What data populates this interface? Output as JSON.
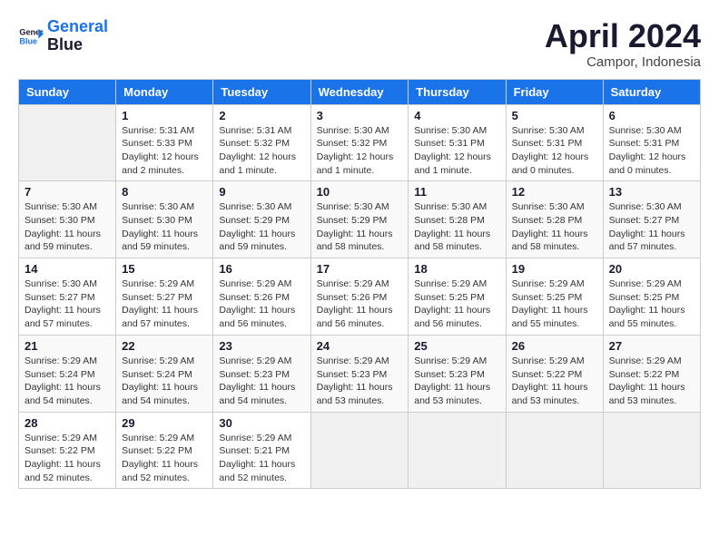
{
  "logo": {
    "line1": "General",
    "line2": "Blue"
  },
  "title": "April 2024",
  "subtitle": "Campor, Indonesia",
  "columns": [
    "Sunday",
    "Monday",
    "Tuesday",
    "Wednesday",
    "Thursday",
    "Friday",
    "Saturday"
  ],
  "weeks": [
    [
      {
        "day": "",
        "sunrise": "",
        "sunset": "",
        "daylight": ""
      },
      {
        "day": "1",
        "sunrise": "5:31 AM",
        "sunset": "5:33 PM",
        "daylight": "12 hours and 2 minutes."
      },
      {
        "day": "2",
        "sunrise": "5:31 AM",
        "sunset": "5:32 PM",
        "daylight": "12 hours and 1 minute."
      },
      {
        "day": "3",
        "sunrise": "5:30 AM",
        "sunset": "5:32 PM",
        "daylight": "12 hours and 1 minute."
      },
      {
        "day": "4",
        "sunrise": "5:30 AM",
        "sunset": "5:31 PM",
        "daylight": "12 hours and 1 minute."
      },
      {
        "day": "5",
        "sunrise": "5:30 AM",
        "sunset": "5:31 PM",
        "daylight": "12 hours and 0 minutes."
      },
      {
        "day": "6",
        "sunrise": "5:30 AM",
        "sunset": "5:31 PM",
        "daylight": "12 hours and 0 minutes."
      }
    ],
    [
      {
        "day": "7",
        "sunrise": "5:30 AM",
        "sunset": "5:30 PM",
        "daylight": "11 hours and 59 minutes."
      },
      {
        "day": "8",
        "sunrise": "5:30 AM",
        "sunset": "5:30 PM",
        "daylight": "11 hours and 59 minutes."
      },
      {
        "day": "9",
        "sunrise": "5:30 AM",
        "sunset": "5:29 PM",
        "daylight": "11 hours and 59 minutes."
      },
      {
        "day": "10",
        "sunrise": "5:30 AM",
        "sunset": "5:29 PM",
        "daylight": "11 hours and 58 minutes."
      },
      {
        "day": "11",
        "sunrise": "5:30 AM",
        "sunset": "5:28 PM",
        "daylight": "11 hours and 58 minutes."
      },
      {
        "day": "12",
        "sunrise": "5:30 AM",
        "sunset": "5:28 PM",
        "daylight": "11 hours and 58 minutes."
      },
      {
        "day": "13",
        "sunrise": "5:30 AM",
        "sunset": "5:27 PM",
        "daylight": "11 hours and 57 minutes."
      }
    ],
    [
      {
        "day": "14",
        "sunrise": "5:30 AM",
        "sunset": "5:27 PM",
        "daylight": "11 hours and 57 minutes."
      },
      {
        "day": "15",
        "sunrise": "5:29 AM",
        "sunset": "5:27 PM",
        "daylight": "11 hours and 57 minutes."
      },
      {
        "day": "16",
        "sunrise": "5:29 AM",
        "sunset": "5:26 PM",
        "daylight": "11 hours and 56 minutes."
      },
      {
        "day": "17",
        "sunrise": "5:29 AM",
        "sunset": "5:26 PM",
        "daylight": "11 hours and 56 minutes."
      },
      {
        "day": "18",
        "sunrise": "5:29 AM",
        "sunset": "5:25 PM",
        "daylight": "11 hours and 56 minutes."
      },
      {
        "day": "19",
        "sunrise": "5:29 AM",
        "sunset": "5:25 PM",
        "daylight": "11 hours and 55 minutes."
      },
      {
        "day": "20",
        "sunrise": "5:29 AM",
        "sunset": "5:25 PM",
        "daylight": "11 hours and 55 minutes."
      }
    ],
    [
      {
        "day": "21",
        "sunrise": "5:29 AM",
        "sunset": "5:24 PM",
        "daylight": "11 hours and 54 minutes."
      },
      {
        "day": "22",
        "sunrise": "5:29 AM",
        "sunset": "5:24 PM",
        "daylight": "11 hours and 54 minutes."
      },
      {
        "day": "23",
        "sunrise": "5:29 AM",
        "sunset": "5:23 PM",
        "daylight": "11 hours and 54 minutes."
      },
      {
        "day": "24",
        "sunrise": "5:29 AM",
        "sunset": "5:23 PM",
        "daylight": "11 hours and 53 minutes."
      },
      {
        "day": "25",
        "sunrise": "5:29 AM",
        "sunset": "5:23 PM",
        "daylight": "11 hours and 53 minutes."
      },
      {
        "day": "26",
        "sunrise": "5:29 AM",
        "sunset": "5:22 PM",
        "daylight": "11 hours and 53 minutes."
      },
      {
        "day": "27",
        "sunrise": "5:29 AM",
        "sunset": "5:22 PM",
        "daylight": "11 hours and 53 minutes."
      }
    ],
    [
      {
        "day": "28",
        "sunrise": "5:29 AM",
        "sunset": "5:22 PM",
        "daylight": "11 hours and 52 minutes."
      },
      {
        "day": "29",
        "sunrise": "5:29 AM",
        "sunset": "5:22 PM",
        "daylight": "11 hours and 52 minutes."
      },
      {
        "day": "30",
        "sunrise": "5:29 AM",
        "sunset": "5:21 PM",
        "daylight": "11 hours and 52 minutes."
      },
      {
        "day": "",
        "sunrise": "",
        "sunset": "",
        "daylight": ""
      },
      {
        "day": "",
        "sunrise": "",
        "sunset": "",
        "daylight": ""
      },
      {
        "day": "",
        "sunrise": "",
        "sunset": "",
        "daylight": ""
      },
      {
        "day": "",
        "sunrise": "",
        "sunset": "",
        "daylight": ""
      }
    ]
  ]
}
